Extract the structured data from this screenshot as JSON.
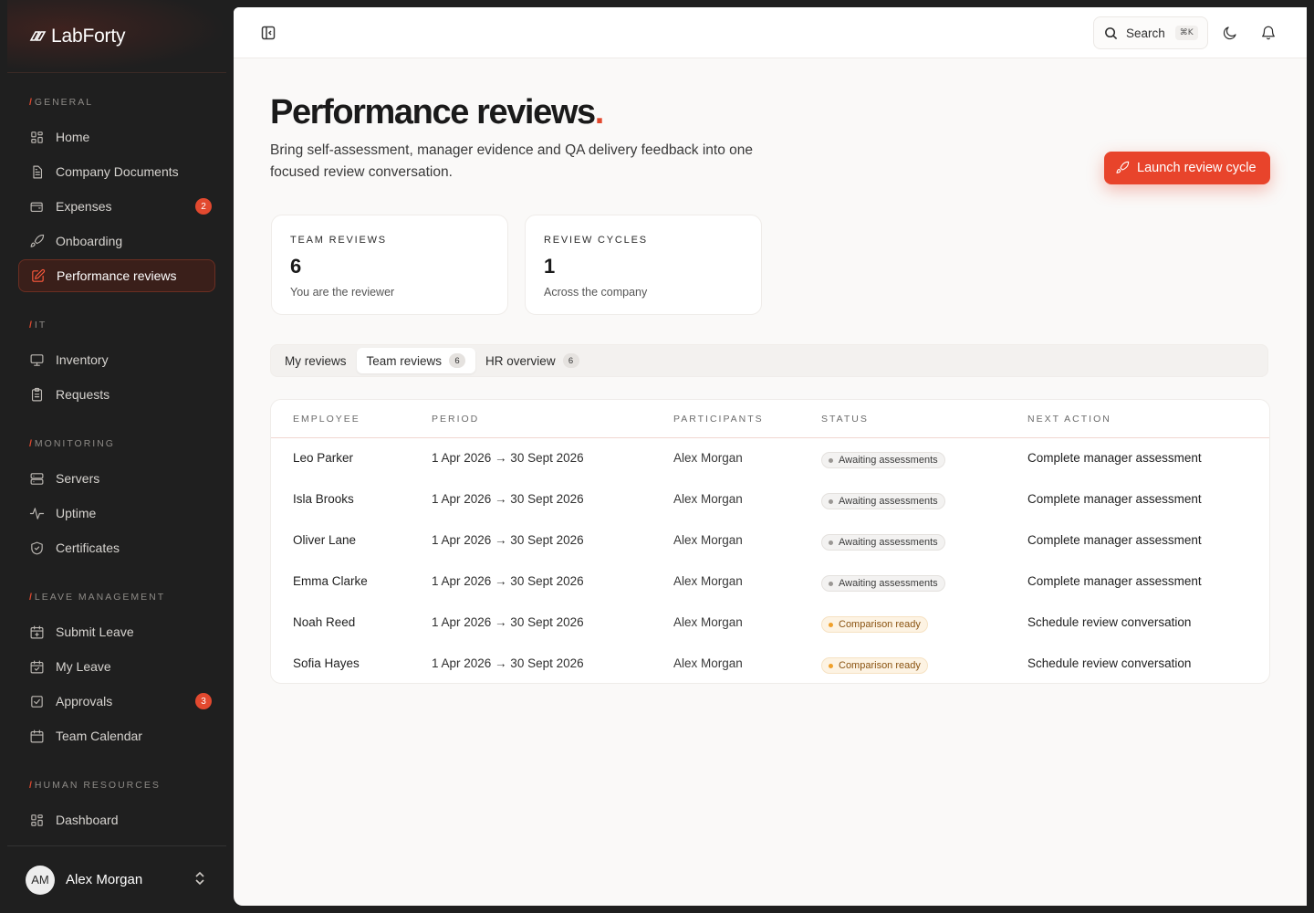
{
  "brand": {
    "name": "LabForty"
  },
  "sidebar": {
    "sections": [
      {
        "label": "GENERAL",
        "items": [
          {
            "label": "Home",
            "icon": "grid-icon"
          },
          {
            "label": "Company Documents",
            "icon": "document-icon"
          },
          {
            "label": "Expenses",
            "icon": "wallet-icon",
            "badge": "2"
          },
          {
            "label": "Onboarding",
            "icon": "rocket-icon"
          },
          {
            "label": "Performance reviews",
            "icon": "edit-icon",
            "active": true
          }
        ]
      },
      {
        "label": "IT",
        "items": [
          {
            "label": "Inventory",
            "icon": "monitor-icon"
          },
          {
            "label": "Requests",
            "icon": "clipboard-icon"
          }
        ]
      },
      {
        "label": "MONITORING",
        "items": [
          {
            "label": "Servers",
            "icon": "server-icon"
          },
          {
            "label": "Uptime",
            "icon": "pulse-icon"
          },
          {
            "label": "Certificates",
            "icon": "shield-icon"
          }
        ]
      },
      {
        "label": "LEAVE MANAGEMENT",
        "items": [
          {
            "label": "Submit Leave",
            "icon": "calendar-plus-icon"
          },
          {
            "label": "My Leave",
            "icon": "calendar-check-icon"
          },
          {
            "label": "Approvals",
            "icon": "checkbox-icon",
            "badge": "3"
          },
          {
            "label": "Team Calendar",
            "icon": "calendar-icon"
          }
        ]
      },
      {
        "label": "HUMAN RESOURCES",
        "items": [
          {
            "label": "Dashboard",
            "icon": "grid-icon"
          }
        ]
      }
    ]
  },
  "user": {
    "initials": "AM",
    "name": "Alex Morgan"
  },
  "topbar": {
    "search_label": "Search",
    "shortcut": "⌘K"
  },
  "page": {
    "title": "Performance reviews",
    "title_dot": ".",
    "description": "Bring self-assessment, manager evidence and QA delivery feedback into one focused review conversation.",
    "launch_label": "Launch review cycle"
  },
  "stats": [
    {
      "label": "TEAM REVIEWS",
      "value": "6",
      "sub": "You are the reviewer"
    },
    {
      "label": "REVIEW CYCLES",
      "value": "1",
      "sub": "Across the company"
    }
  ],
  "tabs": [
    {
      "label": "My reviews"
    },
    {
      "label": "Team reviews",
      "count": "6",
      "active": true
    },
    {
      "label": "HR overview",
      "count": "6"
    }
  ],
  "table": {
    "columns": [
      "EMPLOYEE",
      "PERIOD",
      "PARTICIPANTS",
      "STATUS",
      "NEXT ACTION"
    ],
    "rows": [
      {
        "employee": "Leo Parker",
        "period": "1 Apr 2026 → 30 Sept 2026",
        "participants": "Alex Morgan",
        "status": "Awaiting assessments",
        "status_tone": "grey",
        "next_action": "Complete manager assessment"
      },
      {
        "employee": "Isla Brooks",
        "period": "1 Apr 2026 → 30 Sept 2026",
        "participants": "Alex Morgan",
        "status": "Awaiting assessments",
        "status_tone": "grey",
        "next_action": "Complete manager assessment"
      },
      {
        "employee": "Oliver Lane",
        "period": "1 Apr 2026 → 30 Sept 2026",
        "participants": "Alex Morgan",
        "status": "Awaiting assessments",
        "status_tone": "grey",
        "next_action": "Complete manager assessment"
      },
      {
        "employee": "Emma Clarke",
        "period": "1 Apr 2026 → 30 Sept 2026",
        "participants": "Alex Morgan",
        "status": "Awaiting assessments",
        "status_tone": "grey",
        "next_action": "Complete manager assessment"
      },
      {
        "employee": "Noah Reed",
        "period": "1 Apr 2026 → 30 Sept 2026",
        "participants": "Alex Morgan",
        "status": "Comparison ready",
        "status_tone": "amber",
        "next_action": "Schedule review conversation"
      },
      {
        "employee": "Sofia Hayes",
        "period": "1 Apr 2026 → 30 Sept 2026",
        "participants": "Alex Morgan",
        "status": "Comparison ready",
        "status_tone": "amber",
        "next_action": "Schedule review conversation"
      }
    ]
  },
  "colors": {
    "accent": "#e8442b",
    "sidebar_bg": "#1f1f1f",
    "main_bg": "#faf9f8"
  }
}
